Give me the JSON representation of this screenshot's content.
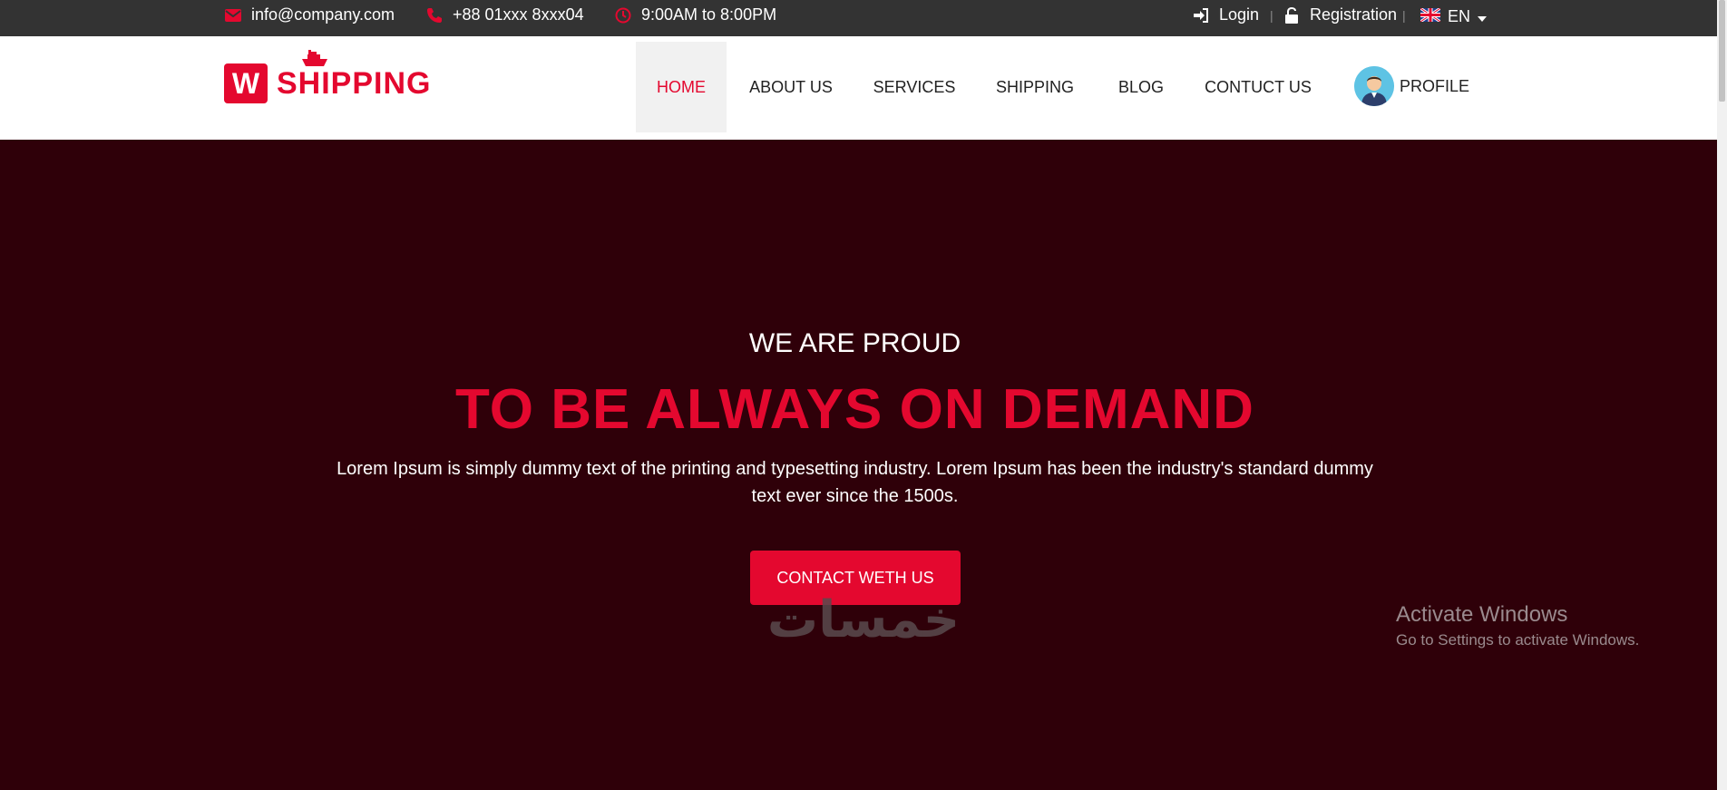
{
  "topbar": {
    "email": "info@company.com",
    "phone": "+88 01xxx 8xxx04",
    "hours": "9:00AM to 8:00PM",
    "login": "Login",
    "registration": "Registration",
    "language": "EN",
    "separator": "|"
  },
  "logo": {
    "letter": "W",
    "text": "SHIPPING"
  },
  "nav": {
    "items": [
      {
        "label": "HOME"
      },
      {
        "label": "ABOUT US"
      },
      {
        "label": "SERVICES"
      },
      {
        "label": "SHIPPING"
      },
      {
        "label": "BLOG"
      },
      {
        "label": "CONTUCT US"
      }
    ],
    "profile": "PROFILE"
  },
  "hero": {
    "subtitle": "WE ARE PROUD",
    "title": "TO BE ALWAYS ON DEMAND",
    "text": "Lorem Ipsum is simply dummy text of the printing and typesetting industry. Lorem Ipsum has been the industry's standard dummy text ever since the 1500s.",
    "cta": "CONTACT WETH US"
  },
  "overlay": {
    "watermark": "خمسات",
    "activate_title": "Activate Windows",
    "activate_sub": "Go to Settings to activate Windows."
  },
  "colors": {
    "accent": "#e4082f",
    "topbar_bg": "#333333",
    "hero_bg": "#2f0009",
    "header_bg": "#ffffff"
  },
  "icons": [
    "envelope-icon",
    "phone-icon",
    "clock-icon",
    "sign-in-icon",
    "unlock-icon",
    "uk-flag-icon",
    "caret-down-icon",
    "ship-icon",
    "avatar"
  ]
}
